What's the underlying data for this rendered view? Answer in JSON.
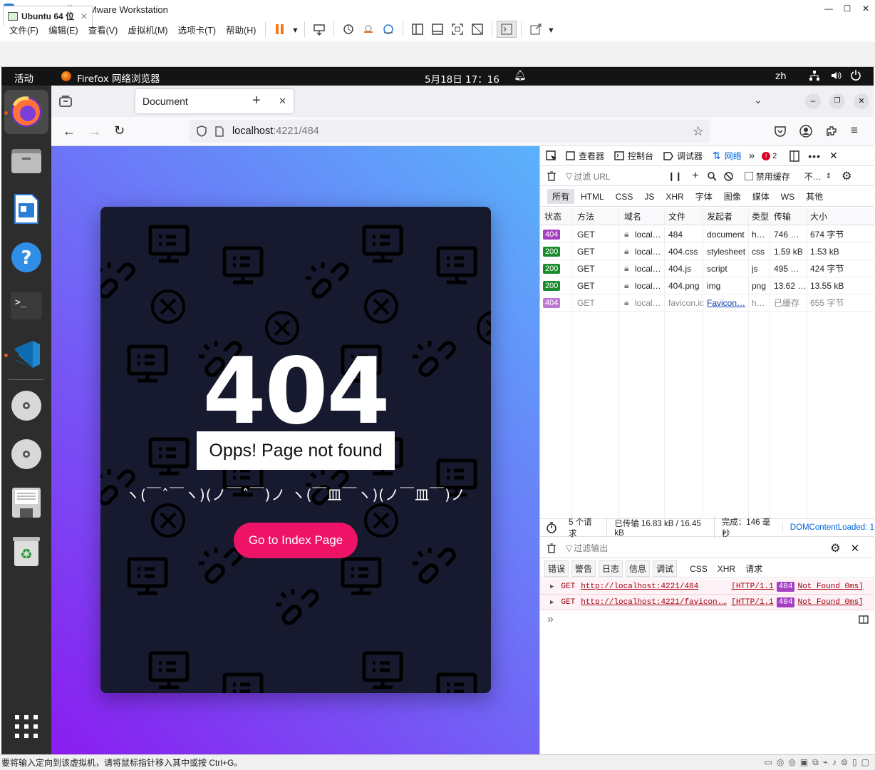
{
  "vmware": {
    "title": "Ubuntu 64 位 - VMware Workstation",
    "menu": [
      "文件(F)",
      "编辑(E)",
      "查看(V)",
      "虚拟机(M)",
      "选项卡(T)",
      "帮助(H)"
    ],
    "tab_label": "Ubuntu 64 位",
    "status_text": "要将输入定向到该虚拟机，请将鼠标指针移入其中或按 Ctrl+G。"
  },
  "gnome": {
    "activities": "活动",
    "app_name": "Firefox 网络浏览器",
    "clock": "5月18日  17：16",
    "input_method": "zh"
  },
  "firefox": {
    "tab_title": "Document",
    "url_host": "localhost",
    "url_rest": ":4221/484"
  },
  "page": {
    "code": "404",
    "message": "Opps! Page not found",
    "kaomoji": "ヽ(￣ˆ￣ヽ)(ノ￣ˆ￣)ノ ヽ(￣皿￣ヽ)(ノ￣皿￣)ノ",
    "button": "Go to Index Page",
    "bg_colors": [
      "#8a1cf0",
      "#5ab2fb"
    ],
    "card_color": "#171a2e",
    "button_color": "#ee1367"
  },
  "devtools": {
    "tabs": [
      "查看器",
      "控制台",
      "调试器",
      "网络"
    ],
    "error_count": "2",
    "filter_placeholder": "过滤 URL",
    "disable_cache": "禁用缓存",
    "throttle": "不…",
    "filter_types": [
      "所有",
      "HTML",
      "CSS",
      "JS",
      "XHR",
      "字体",
      "图像",
      "媒体",
      "WS",
      "其他"
    ],
    "columns": [
      "状态",
      "方法",
      "域名",
      "文件",
      "发起者",
      "类型",
      "传输",
      "大小"
    ],
    "requests": [
      {
        "status": "404",
        "method": "GET",
        "domain": "local…",
        "file": "484",
        "initiator": "document",
        "type": "h…",
        "transferred": "746 …",
        "size": "674 字节"
      },
      {
        "status": "200",
        "method": "GET",
        "domain": "local…",
        "file": "404.css",
        "initiator": "stylesheet",
        "type": "css",
        "transferred": "1.59 kB",
        "size": "1.53 kB"
      },
      {
        "status": "200",
        "method": "GET",
        "domain": "local…",
        "file": "404.js",
        "initiator": "script",
        "type": "js",
        "transferred": "495 …",
        "size": "424 字节"
      },
      {
        "status": "200",
        "method": "GET",
        "domain": "local…",
        "file": "404.png",
        "initiator": "img",
        "type": "png",
        "transferred": "13.62 …",
        "size": "13.55 kB"
      },
      {
        "status": "404",
        "method": "GET",
        "domain": "local…",
        "file": "favicon.ico",
        "initiator": "Favicon…",
        "type": "h…",
        "transferred": "已缓存",
        "size": "655 字节"
      }
    ],
    "summary": {
      "requests": "5 个请求",
      "transferred": "已传输 16.83 kB / 16.45 kB",
      "finish": "完成：146 毫秒",
      "dcl": "DOMContentLoaded: 1"
    },
    "console_filter": "过滤输出",
    "console_levels": [
      "错误",
      "警告",
      "日志",
      "信息",
      "调试"
    ],
    "console_types": [
      "CSS",
      "XHR",
      "请求"
    ],
    "console_logs": [
      {
        "method": "GET",
        "url": "http://localhost:4221/484",
        "prefix": "[HTTP/1.1",
        "code": "404",
        "suffix": "Not Found 0ms]"
      },
      {
        "method": "GET",
        "url": "http://localhost:4221/favicon.…",
        "prefix": "[HTTP/1.1",
        "code": "404",
        "suffix": "Not Found 0ms]"
      }
    ],
    "console_prompt": "»"
  }
}
